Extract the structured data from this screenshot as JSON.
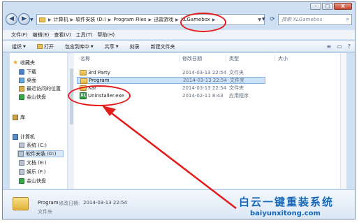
{
  "window": {
    "caption_buttons": {
      "minimize": "-",
      "maximize": "□",
      "close": "X"
    }
  },
  "address_bar": {
    "back_icon": "◀",
    "forward_icon": "▶",
    "segments": [
      "计算机",
      "软件安装 (D:)",
      "Program Files",
      "迅雷游戏",
      "XLGamebox"
    ],
    "separator": "▶",
    "search_placeholder": "搜索 XLGamebox",
    "search_icon": "magnifier",
    "refresh_icon": "⟳"
  },
  "menu": {
    "items": [
      "文件(F)",
      "编辑(E)",
      "查看(V)",
      "工具(T)",
      "帮助(H)"
    ]
  },
  "toolbar": {
    "organize": "组织",
    "open": "打开",
    "include_in_library": "包含到库中",
    "share": "共享",
    "burn": "刻录",
    "new_folder": "新建文件夹",
    "view_icon": "≡",
    "pane_icon": "▭",
    "help_icon": "?"
  },
  "nav_pane": {
    "favorites": {
      "label": "收藏夹",
      "items": [
        "下载",
        "桌面",
        "最近访问的位置",
        "金山快盘"
      ]
    },
    "libraries": {
      "label": "库"
    },
    "computer": {
      "label": "计算机",
      "items": [
        "系统 (C:)",
        "软件安装 (D:)",
        "文档 (E:)",
        "娱乐 (F:)",
        "金山快盘"
      ]
    },
    "selected": "软件安装 (D:)"
  },
  "file_list": {
    "columns": {
      "name": "名称",
      "date": "修改日期",
      "type": "类型",
      "size": "大小"
    },
    "rows": [
      {
        "name": "3rd Party",
        "date": "2014-03-13 22:54",
        "type": "文件夹",
        "size": "",
        "icon": "folder",
        "selected": false
      },
      {
        "name": "Program",
        "date": "2014-03-13 22:54",
        "type": "文件夹",
        "size": "",
        "icon": "folder",
        "selected": true
      },
      {
        "name": "Xar",
        "date": "2014-03-13 22:54",
        "type": "文件夹",
        "size": "",
        "icon": "folder",
        "selected": false
      },
      {
        "name": "Uninstaller.exe",
        "date": "2014-02-11 8:43",
        "type": "应用程序",
        "size": "",
        "icon": "exe",
        "selected": false
      }
    ]
  },
  "details_pane": {
    "name": "Program",
    "modified_label": "修改日期:",
    "modified_value": "2014-03-13 22:54",
    "type": "文件夹"
  },
  "watermark": {
    "title": "白云一键重装系统",
    "url": "baiyunxitong.com"
  },
  "colors": {
    "annotation": "#e31b1b",
    "watermark": "#1667b8",
    "selection": "#cce3fa"
  }
}
